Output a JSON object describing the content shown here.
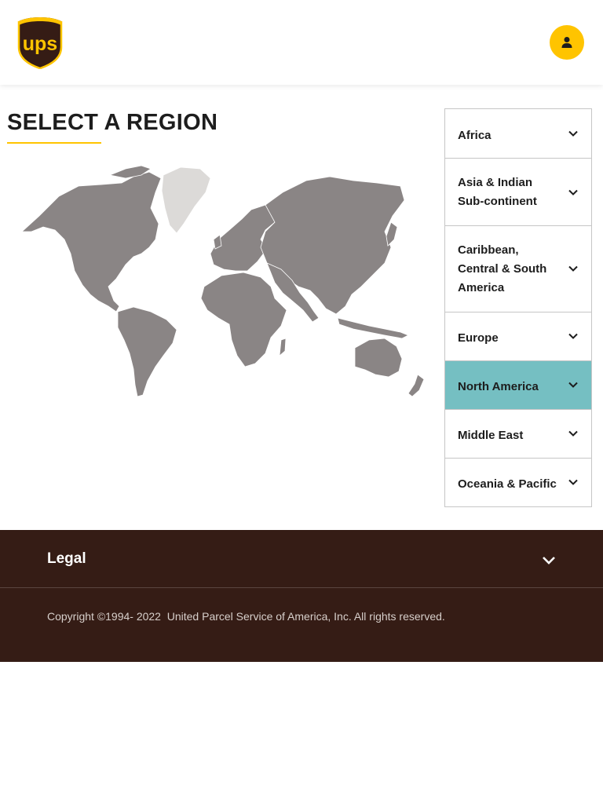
{
  "header": {
    "logo_text": "ups",
    "account_icon": "user-icon"
  },
  "main": {
    "title": "SELECT A REGION",
    "map_icon": "world-map"
  },
  "regions": [
    {
      "label": "Africa",
      "active": false
    },
    {
      "label": "Asia & Indian Sub-continent",
      "active": false
    },
    {
      "label": "Caribbean, Central & South America",
      "active": false
    },
    {
      "label": "Europe",
      "active": false
    },
    {
      "label": "North America",
      "active": true
    },
    {
      "label": "Middle East",
      "active": false
    },
    {
      "label": "Oceania & Pacific",
      "active": false
    }
  ],
  "footer": {
    "legal_label": "Legal",
    "copyright": "Copyright ©1994- 2022  United Parcel Service of America, Inc. All rights reserved."
  },
  "colors": {
    "brand_brown": "#351c15",
    "brand_gold": "#ffc400",
    "active_region": "#75bfc2",
    "map_land": "#8a8585",
    "map_greenland": "#dcdad8"
  }
}
